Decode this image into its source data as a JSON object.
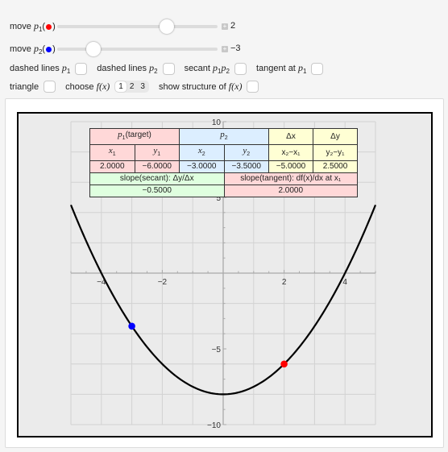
{
  "controls": {
    "slider1": {
      "label_prefix": "move ",
      "var": "p",
      "sub": "1",
      "dot_color": "#ff0000",
      "value": 2,
      "value_text": "2",
      "min": -5,
      "max": 5,
      "plus_icon": "plus-icon"
    },
    "slider2": {
      "label_prefix": "move ",
      "var": "p",
      "sub": "2",
      "dot_color": "#0000ff",
      "value": -3,
      "value_text": "−3",
      "min": -5,
      "max": 5,
      "plus_icon": "plus-icon"
    },
    "checkboxes_row1": [
      {
        "text": "dashed lines ",
        "var": "p",
        "sub": "1",
        "checked": false
      },
      {
        "text": "dashed lines ",
        "var": "p",
        "sub": "2",
        "checked": false
      },
      {
        "text": "secant ",
        "var": "p",
        "sub": "1",
        "var2": "p",
        "sub2": "2",
        "checked": false
      },
      {
        "text": "tangent at ",
        "var": "p",
        "sub": "1",
        "checked": false
      }
    ],
    "triangle_label": "triangle",
    "choose_label": "choose ",
    "choose_func": "f(x)",
    "choose_options": [
      "1",
      "2",
      "3"
    ],
    "choose_selected": "1",
    "structure_label": "show structure of ",
    "structure_func": "f(x)"
  },
  "table": {
    "header1": {
      "p1": "(target)",
      "p1_var": "p",
      "p1_sub": "1",
      "p2_var": "p",
      "p2_sub": "2",
      "dx": "Δx",
      "dy": "Δy"
    },
    "header2": {
      "x1": "x",
      "y1": "y",
      "x2": "x",
      "y2": "y",
      "dx": "x₂−x₁",
      "dy": "y₂−y₁"
    },
    "values": {
      "x1": "2.0000",
      "y1": "−6.0000",
      "x2": "−3.0000",
      "y2": "−3.5000",
      "dx": "−5.0000",
      "dy": "2.5000"
    },
    "secant_label": "slope(secant): Δy/Δx",
    "tangent_label": "slope(tangent): df(x)/dx at x₁",
    "secant_value": "−0.5000",
    "tangent_value": "2.0000"
  },
  "chart_data": {
    "type": "line",
    "function": "f(x) = x^2/2 - 8",
    "x_range": [
      -5,
      5
    ],
    "xlim": [
      -5,
      5
    ],
    "ylim": [
      -10,
      10
    ],
    "x_ticks": [
      -4,
      -2,
      2,
      4
    ],
    "x_tick_labels": [
      "−4",
      "−2",
      "2",
      "4"
    ],
    "y_ticks": [
      10,
      5,
      -5,
      -10
    ],
    "y_tick_labels": [
      "10",
      "5",
      "−5",
      "−10"
    ],
    "grid": true,
    "points": [
      {
        "name": "p1",
        "x": 2,
        "y": -6,
        "color": "#ff0000"
      },
      {
        "name": "p2",
        "x": -3,
        "y": -3.5,
        "color": "#0000ff"
      }
    ],
    "curve_color": "#000000"
  }
}
